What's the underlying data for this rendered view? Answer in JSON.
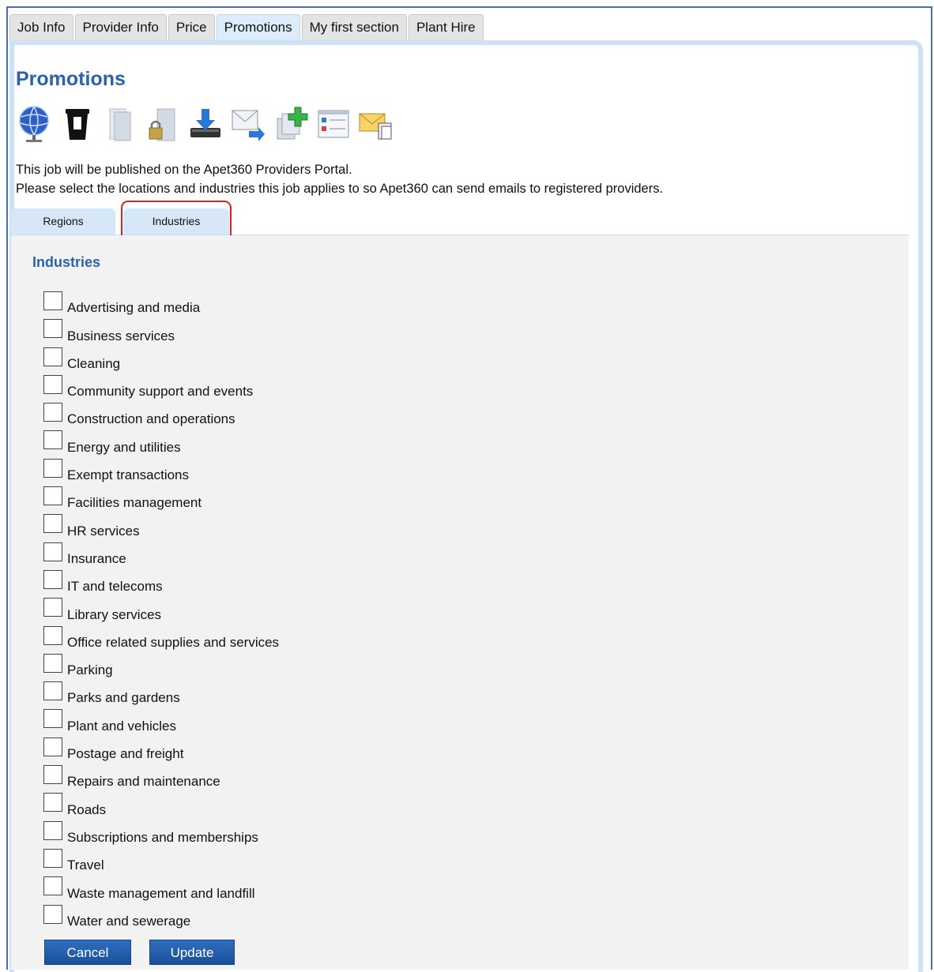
{
  "main_tabs": [
    {
      "label": "Job Info"
    },
    {
      "label": "Provider Info"
    },
    {
      "label": "Price"
    },
    {
      "label": "Promotions",
      "active": true
    },
    {
      "label": "My first section"
    },
    {
      "label": "Plant Hire"
    }
  ],
  "page": {
    "title": "Promotions",
    "intro_line1": "This job will be published on the Apet360 Providers Portal.",
    "intro_line2": "Please select the locations and industries this job applies to so Apet360 can send emails to registered providers."
  },
  "toolbar_icons": [
    "globe-icon",
    "trash-icon",
    "document-icon",
    "lock-document-icon",
    "download-icon",
    "forward-mail-icon",
    "add-copy-icon",
    "list-view-icon",
    "mail-copy-icon"
  ],
  "sub_tabs": {
    "regions": "Regions",
    "industries": "Industries",
    "active": "Industries"
  },
  "industries": {
    "title": "Industries",
    "items": [
      {
        "label": "Advertising and media",
        "checked": false
      },
      {
        "label": "Business services",
        "checked": false
      },
      {
        "label": "Cleaning",
        "checked": false
      },
      {
        "label": "Community support and events",
        "checked": false
      },
      {
        "label": "Construction and operations",
        "checked": false
      },
      {
        "label": "Energy and utilities",
        "checked": false
      },
      {
        "label": "Exempt transactions",
        "checked": false
      },
      {
        "label": "Facilities management",
        "checked": false
      },
      {
        "label": "HR services",
        "checked": false
      },
      {
        "label": "Insurance",
        "checked": false
      },
      {
        "label": "IT and telecoms",
        "checked": false
      },
      {
        "label": "Library services",
        "checked": false
      },
      {
        "label": "Office related supplies and services",
        "checked": false
      },
      {
        "label": "Parking",
        "checked": false
      },
      {
        "label": "Parks and gardens",
        "checked": false
      },
      {
        "label": "Plant and vehicles",
        "checked": false
      },
      {
        "label": "Postage and freight",
        "checked": false
      },
      {
        "label": "Repairs and maintenance",
        "checked": false
      },
      {
        "label": "Roads",
        "checked": false
      },
      {
        "label": "Subscriptions and memberships",
        "checked": false
      },
      {
        "label": "Travel",
        "checked": false
      },
      {
        "label": "Waste management and landfill",
        "checked": false
      },
      {
        "label": "Water and sewerage",
        "checked": false
      }
    ]
  },
  "buttons": {
    "cancel": "Cancel",
    "update": "Update"
  },
  "colors": {
    "accent": "#2d62a8",
    "highlight": "#e02020",
    "button": "#1b4f99"
  }
}
